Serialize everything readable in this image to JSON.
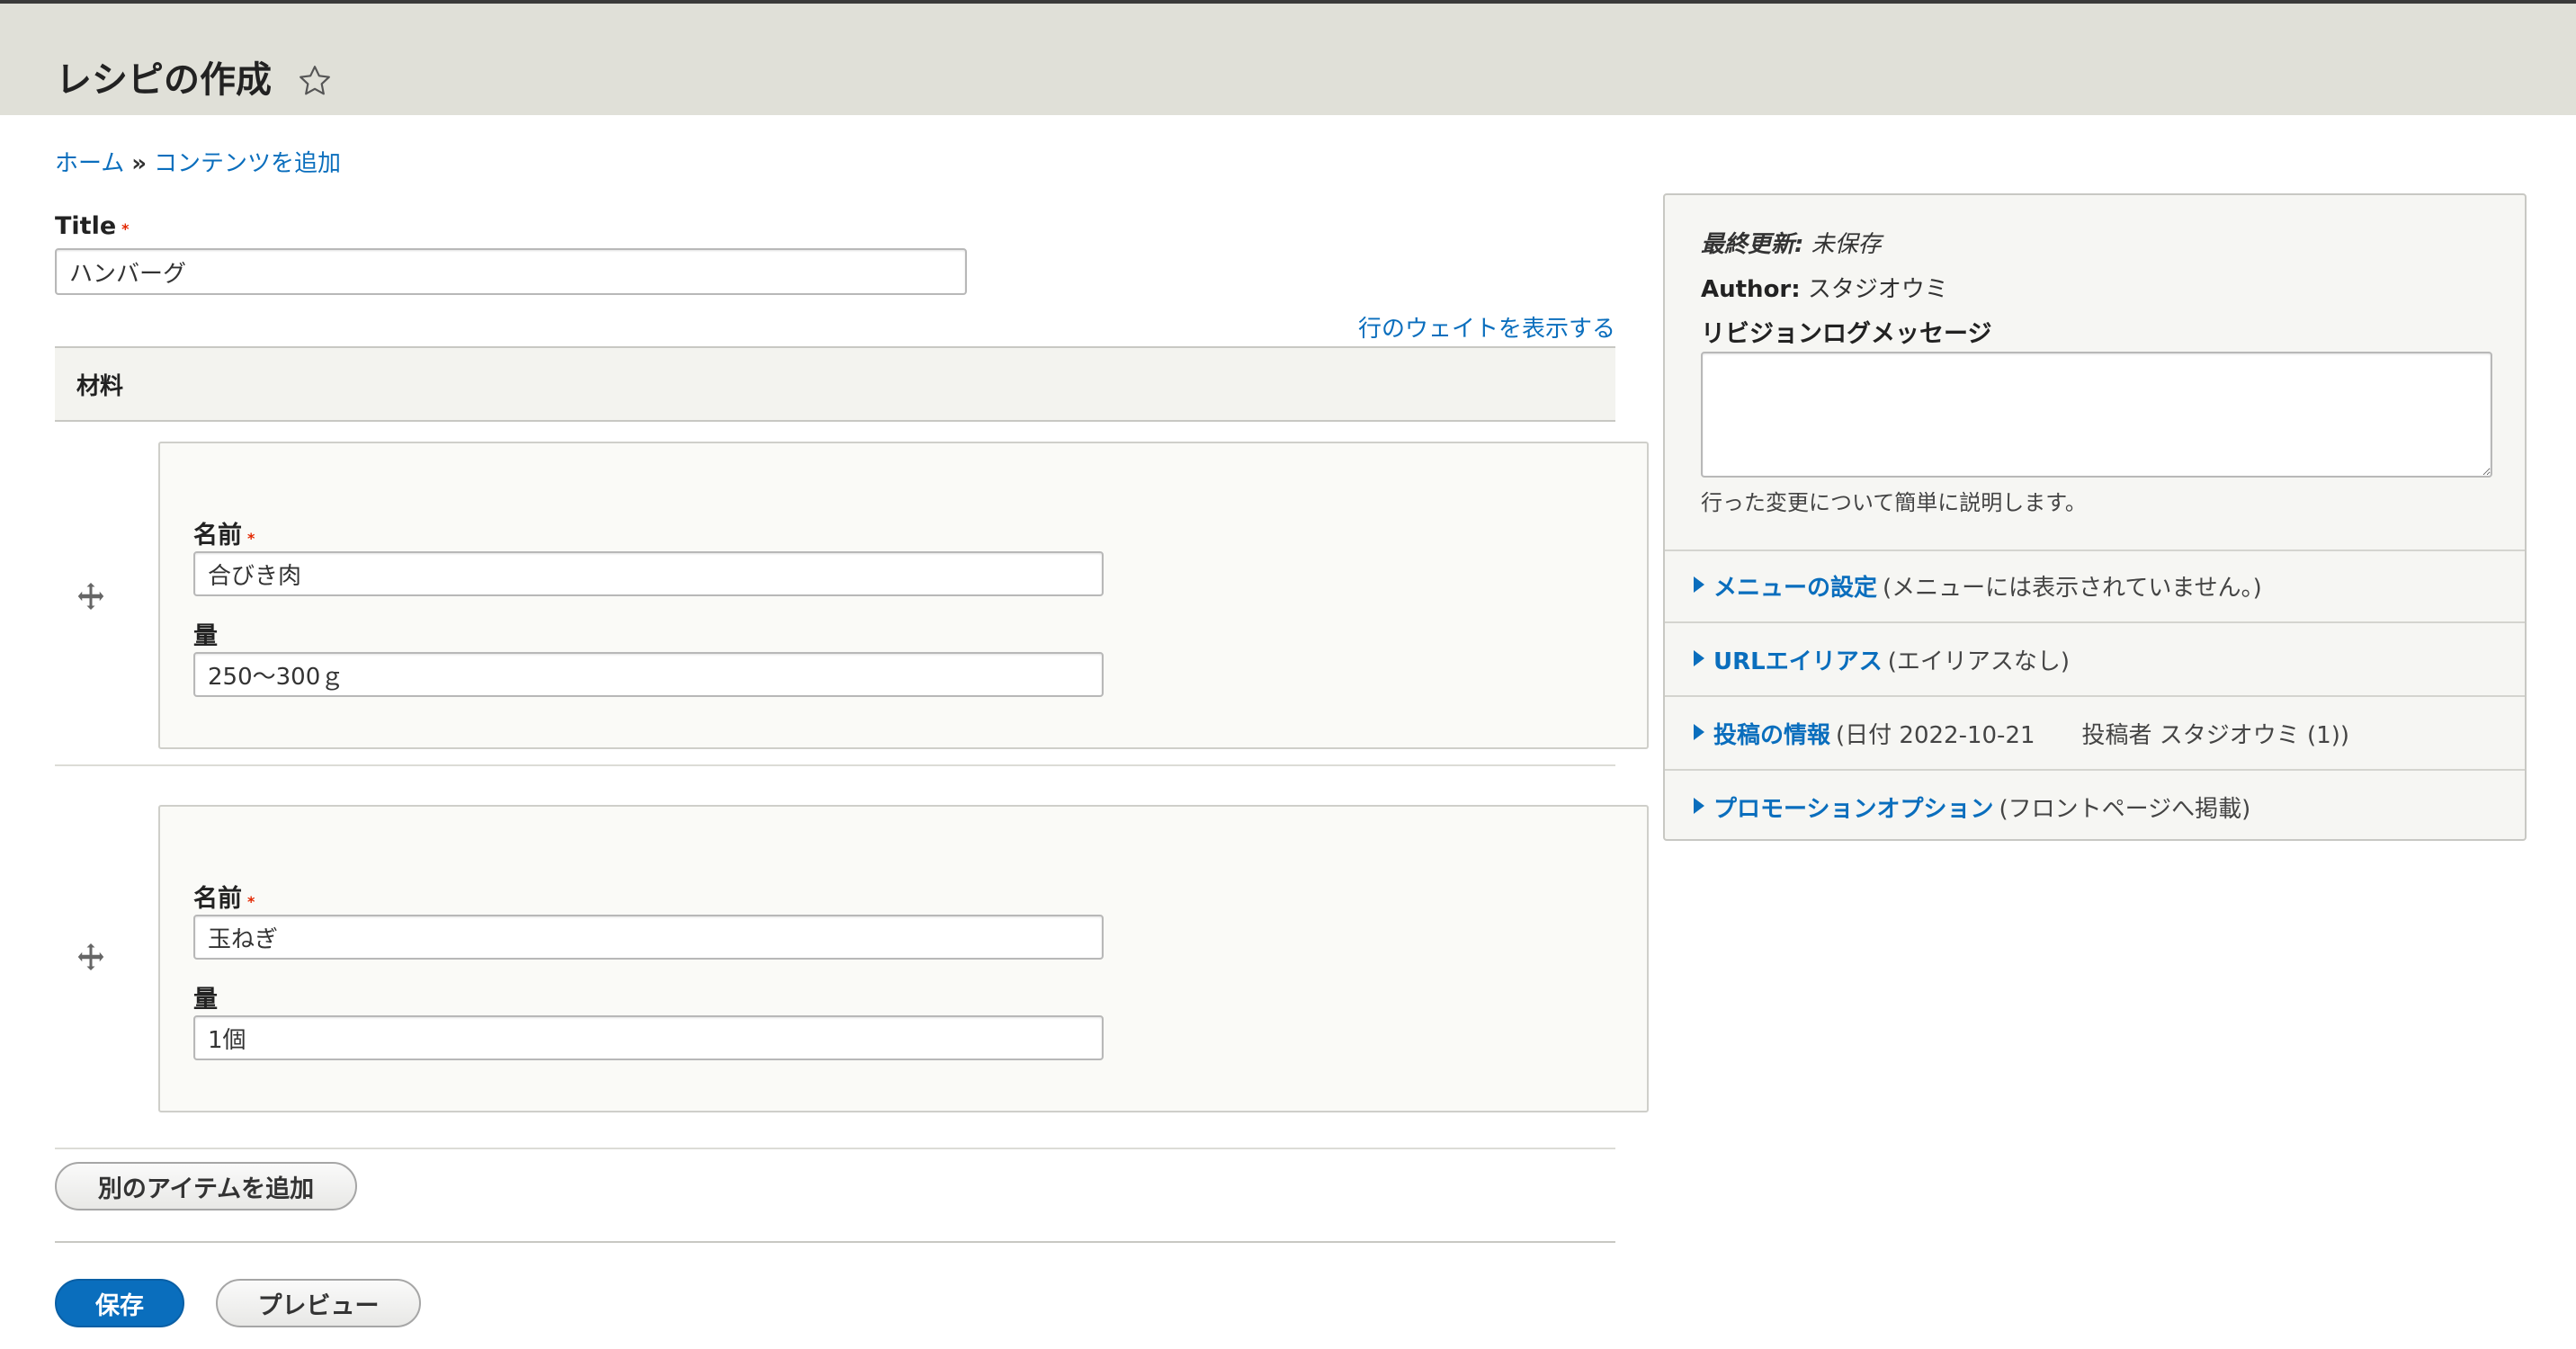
{
  "header": {
    "title": "レシピの作成"
  },
  "breadcrumb": {
    "home": "ホーム",
    "separator": "»",
    "add_content": "コンテンツを追加"
  },
  "title_field": {
    "label": "Title",
    "required_mark": "*",
    "value": "ハンバーグ"
  },
  "table": {
    "show_weights_link": "行のウェイトを表示する",
    "header": "材料",
    "rows": [
      {
        "name_label": "名前",
        "name_value": "合びき肉",
        "qty_label": "量",
        "qty_value": "250〜300ｇ"
      },
      {
        "name_label": "名前",
        "name_value": "玉ねぎ",
        "qty_label": "量",
        "qty_value": "1個"
      }
    ],
    "add_item_button": "別のアイテムを追加"
  },
  "actions": {
    "save": "保存",
    "preview": "プレビュー"
  },
  "sidebar": {
    "last_saved_label": "最終更新:",
    "last_saved_value": "未保存",
    "author_label": "Author:",
    "author_value": "スタジオウミ",
    "revision_label": "リビジョンログメッセージ",
    "revision_value": "",
    "revision_description": "行った変更について簡単に説明します。",
    "sections": [
      {
        "title": "メニューの設定",
        "summary": "(メニューには表示されていません。)"
      },
      {
        "title": "URLエイリアス",
        "summary": "(エイリアスなし)"
      },
      {
        "title": "投稿の情報",
        "summary": "(日付 2022-10-21　　投稿者 スタジオウミ (1))"
      },
      {
        "title": "プロモーションオプション",
        "summary": "(フロントページへ掲載)"
      }
    ]
  },
  "colors": {
    "link": "#0a6ebd",
    "primary_button": "#0a6ebd",
    "required": "#e32700",
    "header_bg": "#e0e0d8"
  },
  "icons": {
    "favorite": "star-outline-icon",
    "drag": "move-arrows-icon",
    "disclosure": "triangle-right-icon"
  }
}
